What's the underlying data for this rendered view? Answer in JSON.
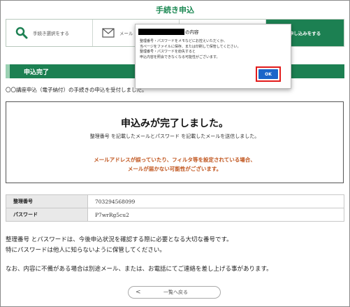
{
  "page": {
    "title": "手続き申込"
  },
  "steps": [
    {
      "label": "手続き選択をする",
      "icon": "search-icon",
      "active": false
    },
    {
      "label": "メール",
      "icon": "mail-icon",
      "active": false
    },
    {
      "label": "",
      "icon": "",
      "active": false
    },
    {
      "label": "申し込みをする",
      "icon": "",
      "active": true
    }
  ],
  "section": {
    "title": "申込完了"
  },
  "intro": "〇〇講座申込（電子納付）の手続きの申込を受付しました。",
  "completion_box": {
    "heading": "申込みが完了しました。",
    "subtext": "整理番号 を記載したメールとパスワード を記載したメールを送信しました。",
    "warning_line1": "メールアドレスが誤っていたり、フィルタ等を設定されている場合、",
    "warning_line2": "メールが届かない可能性がございます。"
  },
  "details": [
    {
      "label": "整理番号",
      "value": "703294568099"
    },
    {
      "label": "パスワード",
      "value": "P7wrRg5cu2"
    }
  ],
  "notes": {
    "line1": "整理番号 とパスワードは、今後申込状況を確認する際に必要となる大切な番号です。",
    "line2": "特にパスワードは他人に知らないように保管してください。",
    "line3": "なお、内容に不備がある場合は別途メール、または、お電話にてご連絡を差し上げる事があります。"
  },
  "back_button": {
    "arrow": "<",
    "label": "一覧へ戻る"
  },
  "dialog": {
    "title_suffix": "の内容",
    "message_line1": "整理番号・パスワードをメモなどにお控えいただくか、",
    "message_line2": "当ページをファイルに保存、または印刷して保管してください。",
    "message_line3": "整理番号・パスワードを紛失すると",
    "message_line4": "申込内容を照会できなくなる可能性がございます。",
    "ok_label": "OK"
  },
  "colors": {
    "brand_green": "#1c8052",
    "warning_orange": "#c0541c",
    "ok_blue": "#1a66c9",
    "highlight_red": "#e21b1b"
  }
}
